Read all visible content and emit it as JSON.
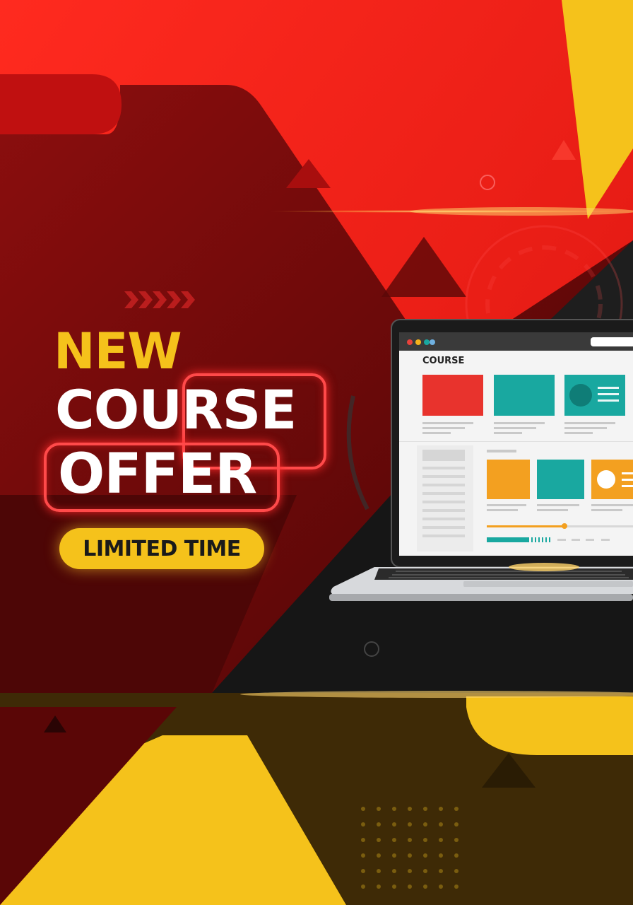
{
  "headline": {
    "line1": "NEW",
    "line2": "COURSE",
    "line3": "OFFER",
    "badge": "LIMITED TIME"
  },
  "laptop_screen": {
    "title": "COURSE"
  },
  "colors": {
    "red": "#ee1c1c",
    "dark_red": "#6e0a0a",
    "yellow": "#f5c21b",
    "black": "#151515",
    "teal": "#19a8a0",
    "orange": "#f3a020"
  }
}
